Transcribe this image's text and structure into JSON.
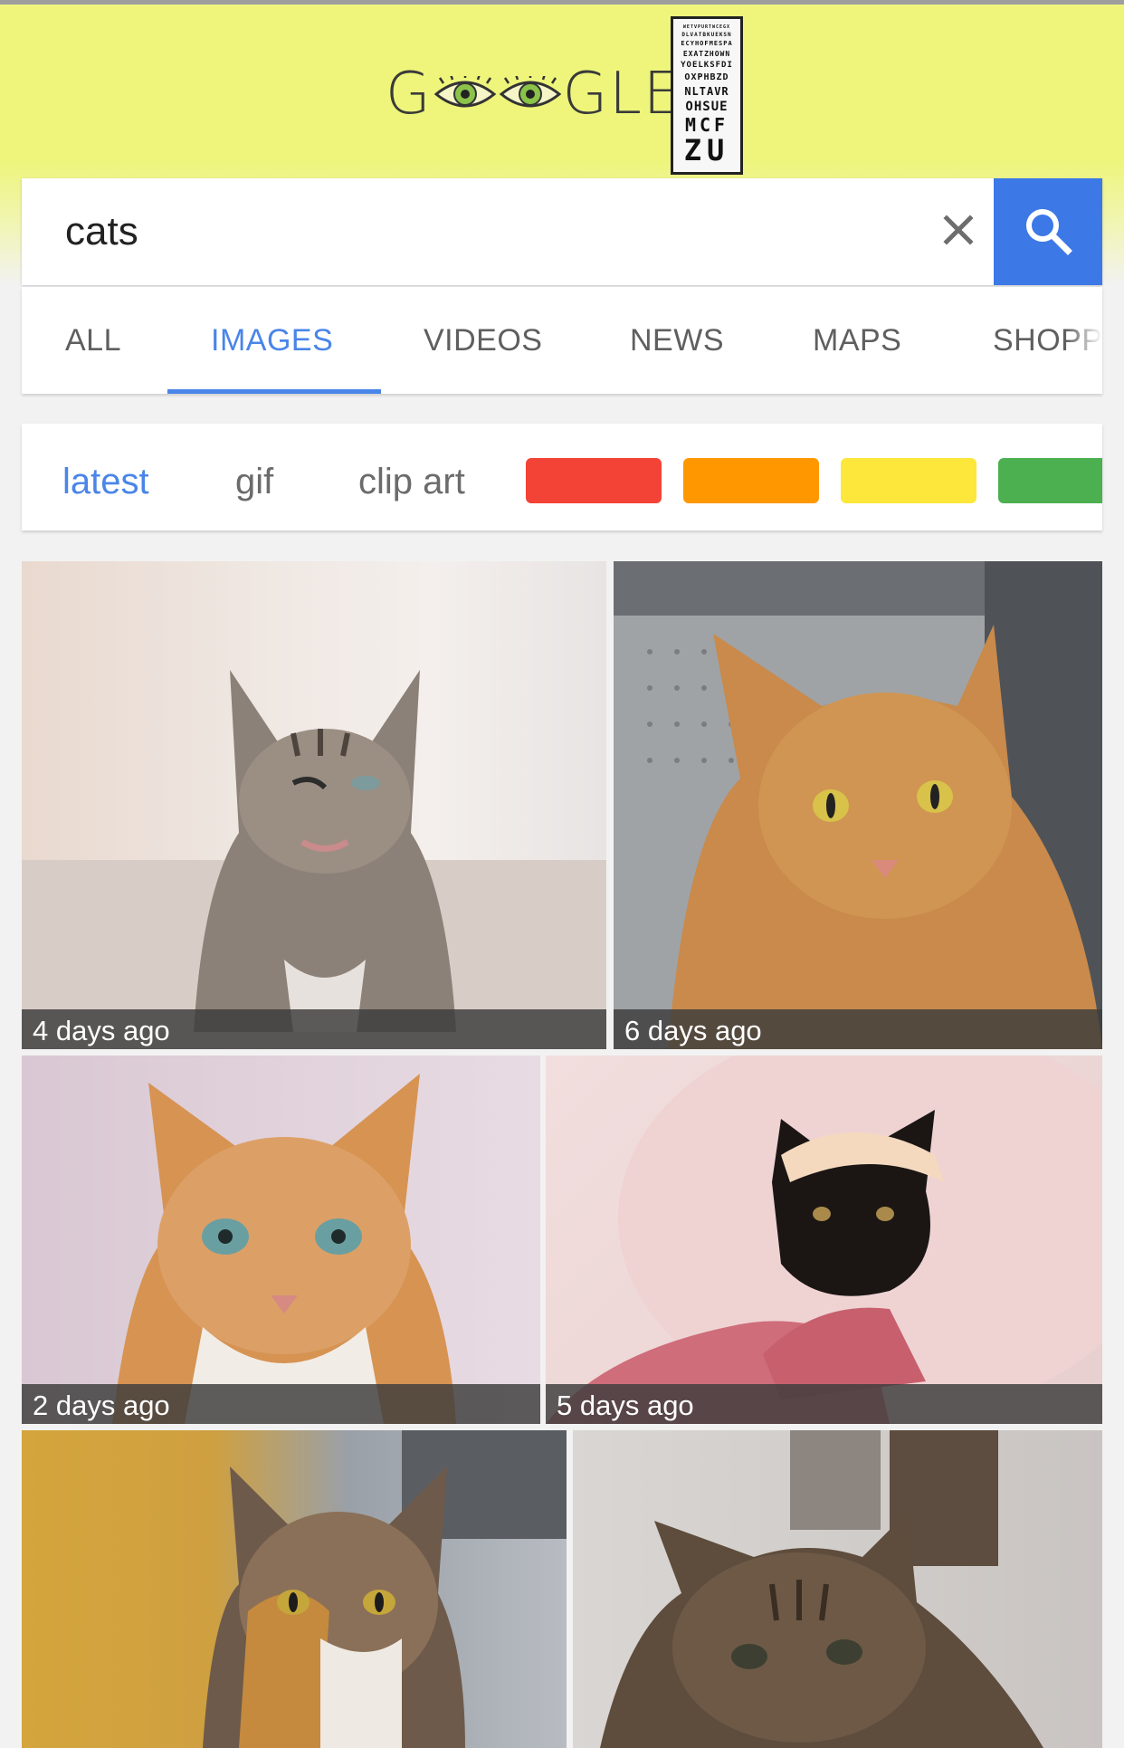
{
  "logo": {
    "text_left": "G",
    "text_right": "GLE",
    "eye_chart_rows": [
      "WETVPURTWCEGX",
      "DLVATBKUEKSN",
      "ECYHOFMESPA",
      "EXATZHOWN",
      "YOELKSFDI",
      "OXPHBZD",
      "NLTAVR",
      "OHSUE",
      "MCF",
      "ZU"
    ]
  },
  "search": {
    "query": "cats",
    "clear_icon": "close-icon",
    "search_icon": "search-icon"
  },
  "tabs": [
    "ALL",
    "IMAGES",
    "VIDEOS",
    "NEWS",
    "MAPS",
    "SHOPP"
  ],
  "active_tab": "IMAGES",
  "chips": {
    "latest": "latest",
    "gif": "gif",
    "clip_art": "clip art",
    "colors": [
      "#f34336",
      "#ff9800",
      "#fde73a",
      "#4caf50"
    ]
  },
  "results": [
    {
      "caption": "4 days ago",
      "subject": "tabby kitten winking"
    },
    {
      "caption": "6 days ago",
      "subject": "orange cat in carrier"
    },
    {
      "caption": "2 days ago",
      "subject": "orange and white cat"
    },
    {
      "caption": "5 days ago",
      "subject": "black kitten in pink blanket"
    },
    {
      "caption": "",
      "subject": "calico cat"
    },
    {
      "caption": "",
      "subject": "long-haired tabby cat"
    }
  ]
}
